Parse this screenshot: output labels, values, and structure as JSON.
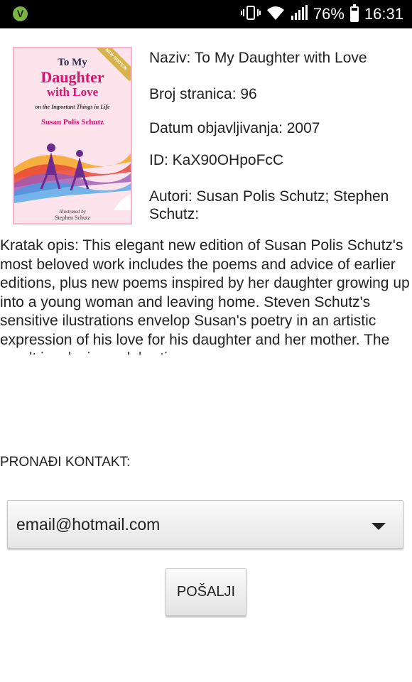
{
  "status_bar": {
    "app_badge": "V",
    "battery": "76%",
    "time": "16:31",
    "icons": [
      "vibrate-icon",
      "wifi-icon",
      "signal-icon",
      "battery-icon"
    ]
  },
  "cover": {
    "line1": "To My",
    "line2": "Daughter",
    "line3": "with Love",
    "line4": "on the Important Things in Life",
    "line5": "Susan Polis Schutz",
    "illustrated_by": "Illustrated by",
    "illustrator": "Stephen Schutz",
    "ribbon": "NEW EDITION"
  },
  "book": {
    "title": "Naziv: To My Daughter with Love",
    "pages": "Broj stranica: 96",
    "published": "Datum objavljivanja: 2007",
    "id": "ID: KaX90OHpoFcC",
    "authors": "Autori: Susan Polis Schutz; Stephen Schutz;",
    "summary": "Kratak opis: This elegant new edition of Susan Polis Schutz's most beloved work includes the poems and advice of earlier editions, plus new poems inspired by her daughter growing up into a young woman and leaving home. Steven Schutz's sensitive ilustrations envelop Susan's poetry in an artistic expression of his love for his daughter and her mother. The result is a loving celebration"
  },
  "contact": {
    "label": "PRONAĐI KONTAKT:",
    "selected": "email@hotmail.com",
    "send_label": "POŠALJI"
  }
}
